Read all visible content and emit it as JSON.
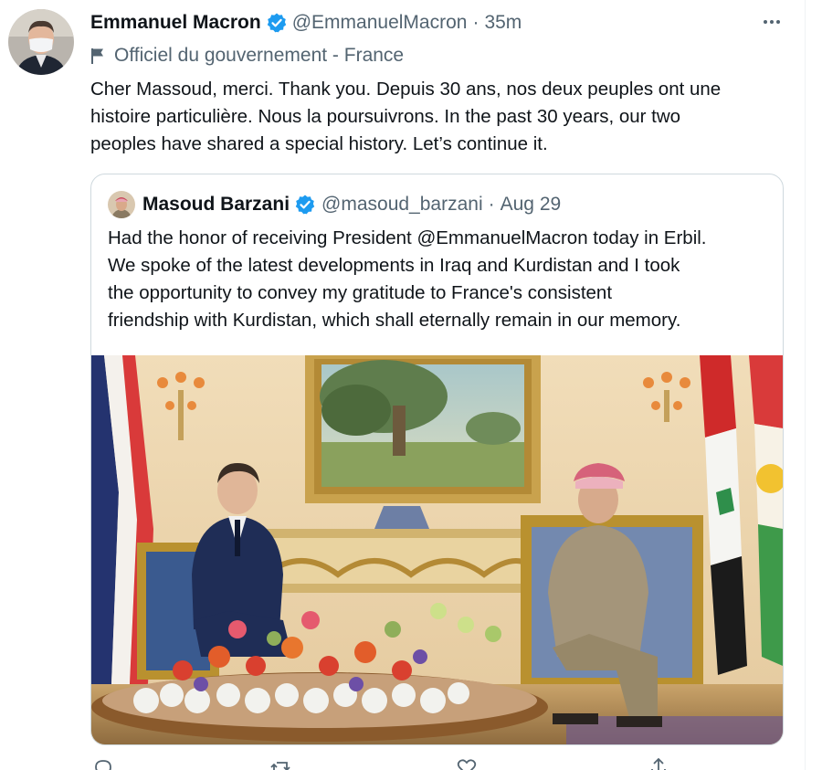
{
  "tweet": {
    "author_name": "Emmanuel Macron",
    "author_handle": "@EmmanuelMacron",
    "separator": "·",
    "time": "35m",
    "label": "Officiel du gouvernement - France",
    "text": "Cher Massoud, merci. Thank you. Depuis 30 ans, nos deux peuples ont une\nhistoire particulière. Nous la poursuivrons. In the past 30 years, our two\npeoples have shared a special history. Let’s continue it."
  },
  "quoted": {
    "author_name": "Masoud Barzani",
    "author_handle": "@masoud_barzani",
    "separator": "·",
    "time": "Aug 29",
    "text": "Had the honor of receiving President @EmmanuelMacron today in Erbil.\nWe spoke of the latest developments in Iraq and Kurdistan and I took\nthe opportunity to convey my gratitude to France's consistent\nfriendship with Kurdistan, which shall eternally remain in our memory."
  },
  "icons": {
    "verified": "verified-badge-icon",
    "label": "flag-icon",
    "more": "more-options-icon",
    "actions": [
      "reply-icon",
      "retweet-icon",
      "like-icon",
      "share-icon"
    ]
  },
  "colors": {
    "primary_text": "#0f1419",
    "secondary_text": "#536471",
    "verified_blue": "#1d9bf0",
    "border": "#cfd9de"
  }
}
